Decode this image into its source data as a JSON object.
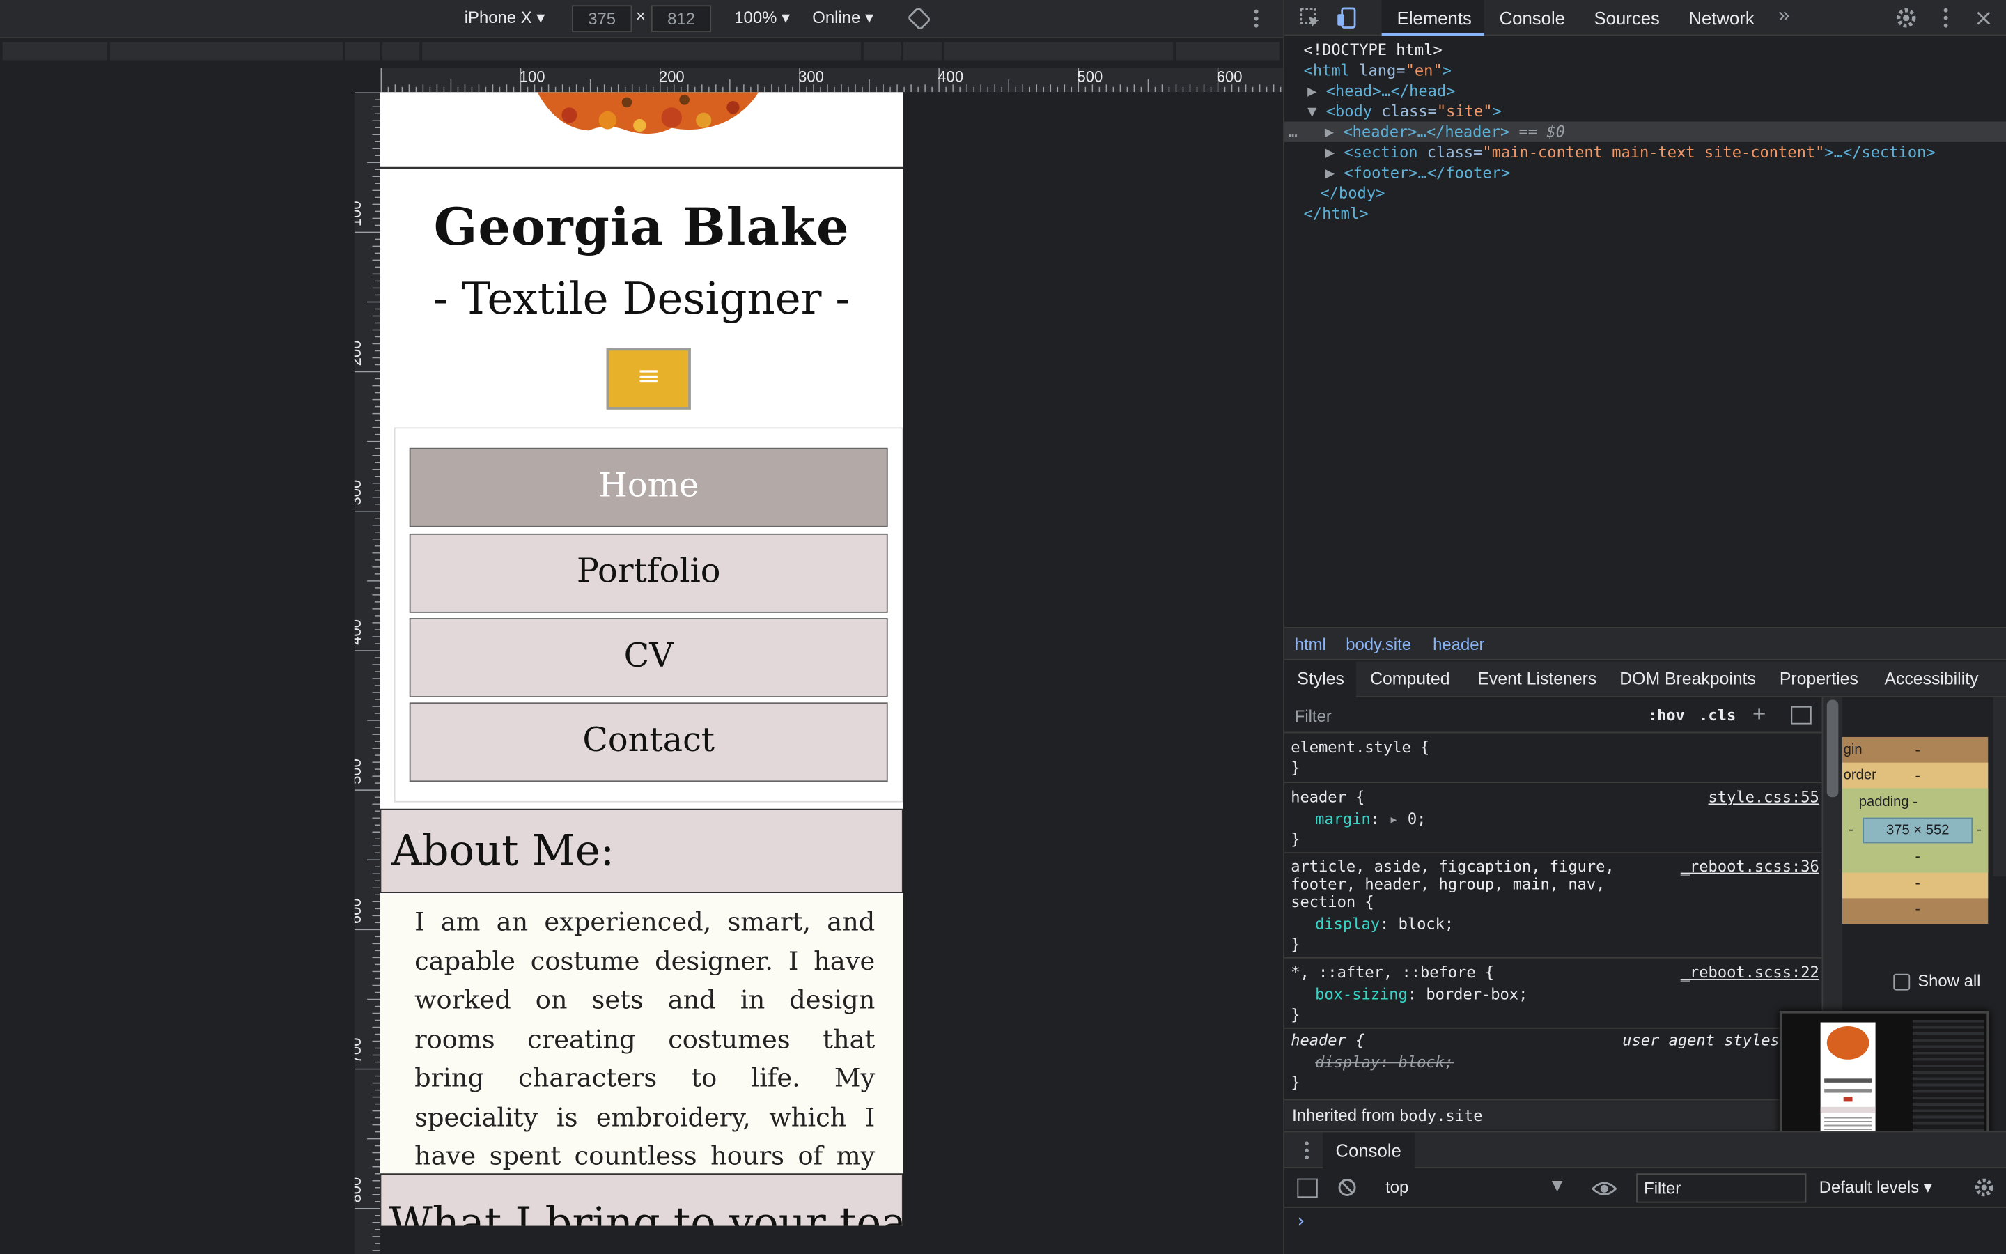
{
  "device_toolbar": {
    "device": "iPhone X",
    "width": "375",
    "times": "×",
    "height": "812",
    "zoom": "100%",
    "throttle": "Online"
  },
  "ruler": {
    "h_labels": [
      "100",
      "200",
      "300",
      "400",
      "500",
      "600"
    ],
    "v_labels": [
      "100",
      "200",
      "300",
      "400",
      "500",
      "600",
      "700",
      "800"
    ]
  },
  "site": {
    "name": "Georgia Blake",
    "subtitle": "- Textile Designer -",
    "menu_icon": "≡",
    "nav": [
      "Home",
      "Portfolio",
      "CV",
      "Contact"
    ],
    "about_title": "About Me:",
    "about_text": "I am an experienced, smart, and capable costume designer. I have worked on sets and in design rooms creating costumes that bring characters to life. My speciality is embroidery, which I have spent countless hours of my own time practicing.",
    "team_title": "What I bring to your team:"
  },
  "devtools": {
    "tabs": [
      "Elements",
      "Console",
      "Sources",
      "Network"
    ],
    "more": "»",
    "dom": {
      "doctype": "<!DOCTYPE html>",
      "html_open": "<html",
      "lang_attr": " lang=",
      "lang_val": "\"en\"",
      "head": "<head>…</head>",
      "body_open": "<body",
      "class_attr": " class=",
      "body_class": "\"site\"",
      "header": "<header>…</header>",
      "selected_marker": "== $0",
      "section_open": "<section",
      "section_class": "\"main-content main-text site-content\"",
      "section_close": ">…</section>",
      "footer": "<footer>…</footer>",
      "body_close": "</body>",
      "html_close": "</html>",
      "ellipsis": "…"
    },
    "breadcrumbs": [
      "html",
      "body.site",
      "header"
    ],
    "subtabs": [
      "Styles",
      "Computed",
      "Event Listeners",
      "DOM Breakpoints",
      "Properties",
      "Accessibility"
    ],
    "filter_placeholder": "Filter",
    "hov": ":hov",
    "cls": ".cls",
    "rules": {
      "r1_sel": "element.style {",
      "close": "}",
      "r2_sel": "header {",
      "r2_src": "style.css:55",
      "r2_prop": "margin",
      "r2_val": "0;",
      "r3_sel1": "article, aside, figcaption, figure,",
      "r3_sel2": "footer, header, hgroup, main, nav,",
      "r3_sel3": "section {",
      "r3_src": "_reboot.scss:36",
      "r3_prop": "display",
      "r3_val": "block;",
      "r4_sel": "*, ::after, ::before {",
      "r4_src": "_reboot.scss:22",
      "r4_prop": "box-sizing",
      "r4_val": "border-box;",
      "r5_sel": "header {",
      "r5_src": "user agent styles",
      "r5_strike": "display: block;",
      "inherited_label": "Inherited from ",
      "inherited_from": "body.site"
    },
    "boxmodel": {
      "margin": "gin",
      "border": "order",
      "padding": "padding -",
      "content": "375 × 552",
      "dash": "-",
      "show_all": "Show all"
    },
    "console": {
      "tab": "Console",
      "context": "top",
      "filter_placeholder": "Filter",
      "levels": "Default levels",
      "prompt": "›"
    }
  },
  "colors": {
    "menu_button": "#e8b12a",
    "nav_active": "#b3a9a7",
    "nav_bg": "#e3d8d9",
    "selected_tab_underline": "#8ab4f8"
  }
}
